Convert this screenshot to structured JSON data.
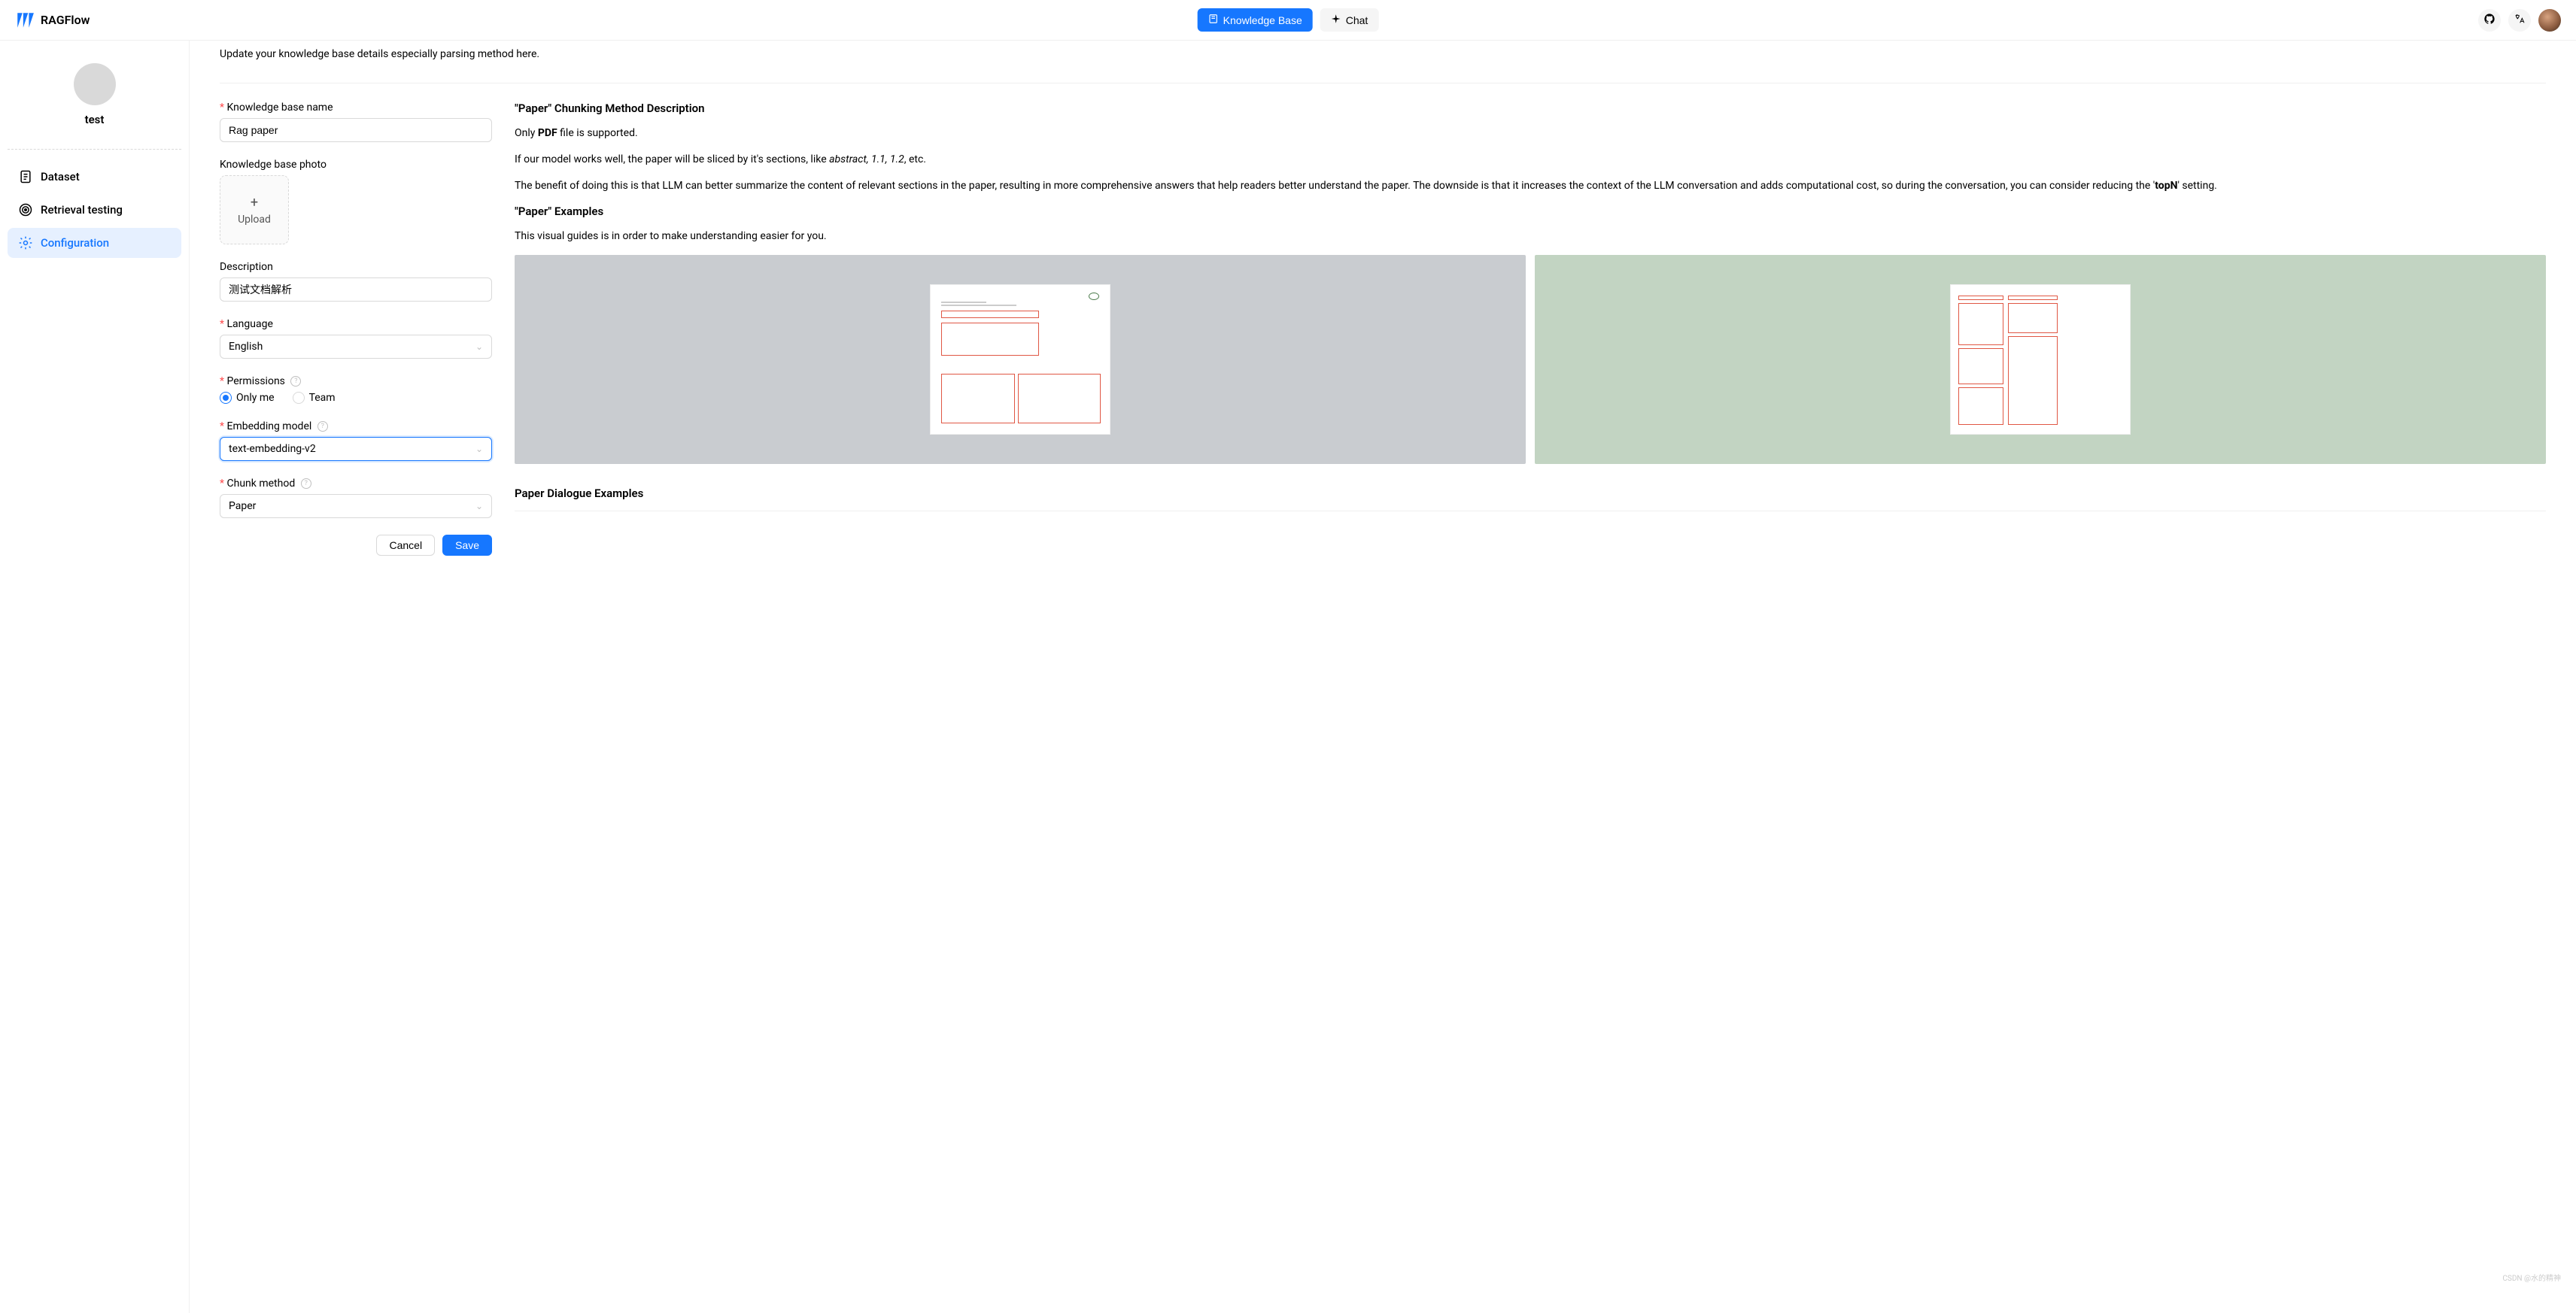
{
  "header": {
    "logo_text": "RAGFlow",
    "nav_knowledge": "Knowledge Base",
    "nav_chat": "Chat"
  },
  "sidebar": {
    "workspace_name": "test",
    "items": [
      {
        "label": "Dataset"
      },
      {
        "label": "Retrieval testing"
      },
      {
        "label": "Configuration"
      }
    ]
  },
  "subtitle": "Update your knowledge base details especially parsing method here.",
  "form": {
    "kb_name_label": "Knowledge base name",
    "kb_name_value": "Rag paper",
    "kb_photo_label": "Knowledge base photo",
    "upload_text": "Upload",
    "description_label": "Description",
    "description_value": "测试文档解析",
    "language_label": "Language",
    "language_value": "English",
    "permissions_label": "Permissions",
    "perm_only_me": "Only me",
    "perm_team": "Team",
    "embedding_label": "Embedding model",
    "embedding_value": "text-embedding-v2",
    "chunk_label": "Chunk method",
    "chunk_value": "Paper",
    "cancel": "Cancel",
    "save": "Save"
  },
  "info": {
    "desc_heading": "\"Paper\" Chunking Method Description",
    "support_pre": "Only ",
    "support_bold": "PDF",
    "support_post": " file is supported.",
    "sliced_pre": "If our model works well, the paper will be sliced by it's sections, like ",
    "sliced_italic": "abstract, 1.1, 1.2",
    "sliced_post": ", etc.",
    "benefit_pre": "The benefit of doing this is that LLM can better summarize the content of relevant sections in the paper, resulting in more comprehensive answers that help readers better understand the paper. The downside is that it increases the context of the LLM conversation and adds computational cost, so during the conversation, you can consider reducing the '",
    "benefit_bold": "topN",
    "benefit_post": "' setting.",
    "examples_heading": "\"Paper\" Examples",
    "examples_caption": "This visual guides is in order to make understanding easier for you.",
    "dialogue_heading": "Paper Dialogue Examples"
  },
  "watermark": "CSDN @水的精神"
}
